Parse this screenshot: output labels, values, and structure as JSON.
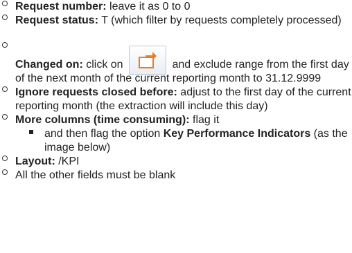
{
  "items": [
    {
      "label": "Request number:",
      "text": " leave it as 0 to 0"
    },
    {
      "label": "Request status:",
      "text": " T (which filter by requests completely processed)"
    },
    {
      "label": "Changed on:",
      "text_before": " click on",
      "icon": "multiple-selection-arrow-icon",
      "text_after": " and exclude range from the first day of the next month of the current reporting month to 31.12.9999"
    },
    {
      "label": "Ignore requests closed before:",
      "text": " adjust to the first day of the current reporting month (the extraction will include this day)"
    },
    {
      "label": "More columns (time consuming):",
      "text": " flag it"
    },
    {
      "label": "Layout:",
      "text": " /KPI"
    },
    {
      "text": "All the other fields must be blank"
    }
  ],
  "subitem": {
    "text_before": "and then flag the option ",
    "label": "Key Performance Indicators",
    "text_after": " (as the image below)"
  },
  "colors": {
    "text": "#222222",
    "icon_orange": "#f07b1e",
    "icon_border": "#bfc8d4"
  }
}
